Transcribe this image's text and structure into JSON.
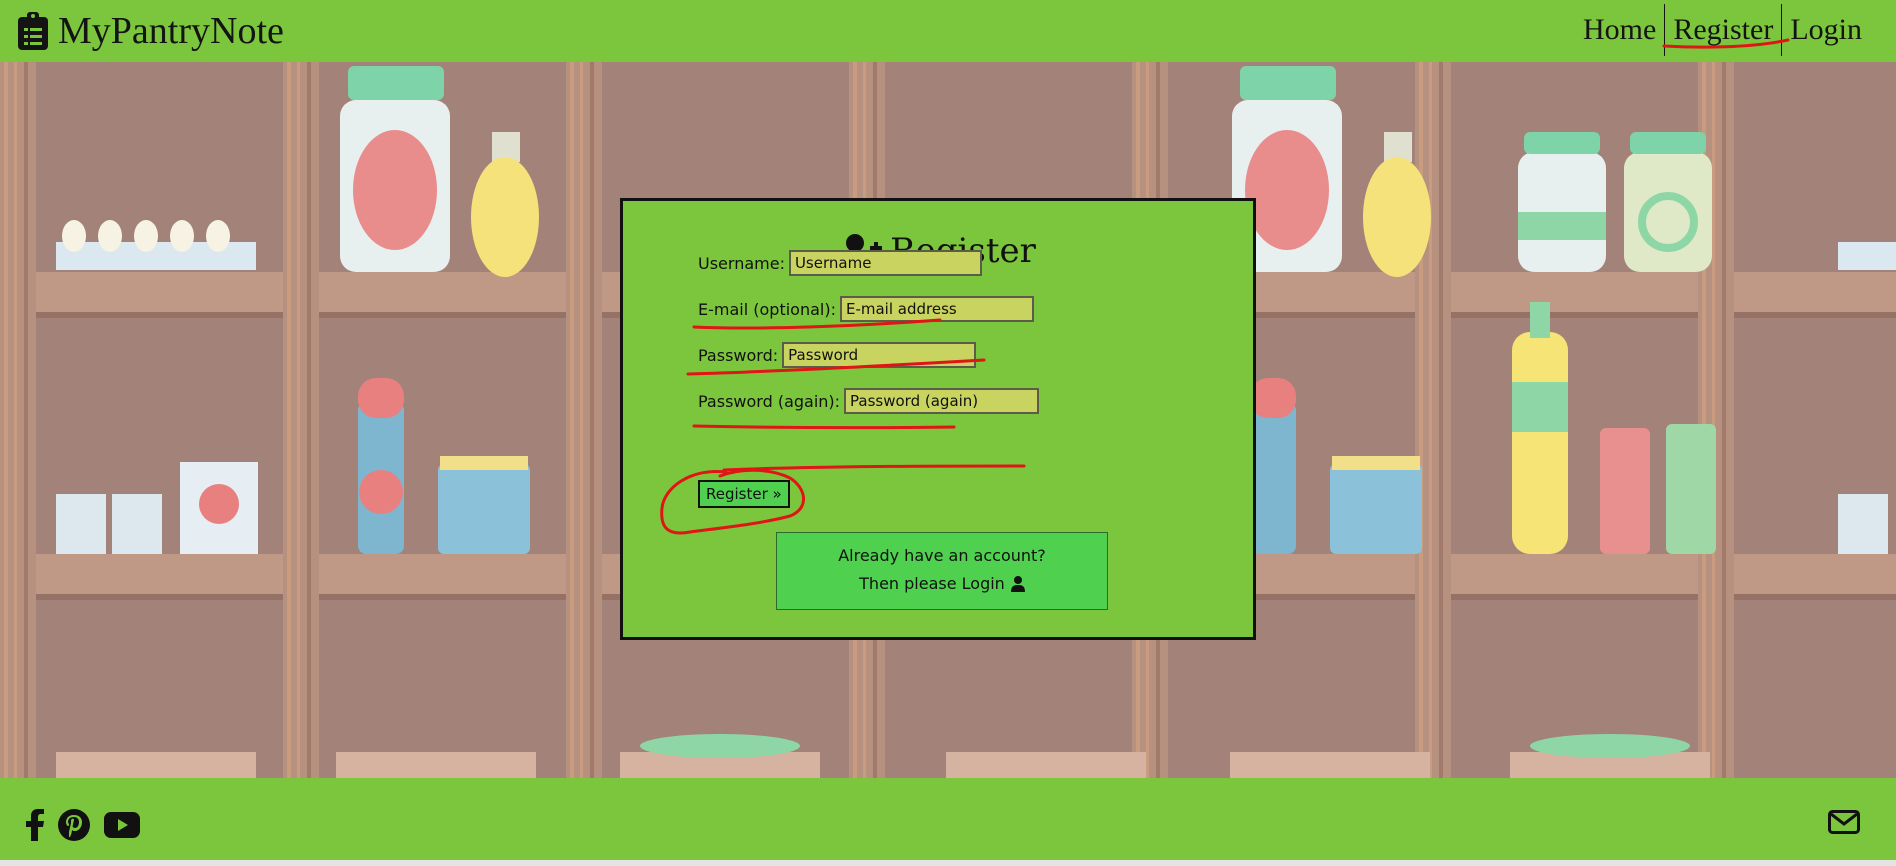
{
  "header": {
    "brand": "MyPantryNote",
    "nav": [
      {
        "label": "Home"
      },
      {
        "label": "Register"
      },
      {
        "label": "Login"
      }
    ]
  },
  "register_form": {
    "title": "Register",
    "fields": [
      {
        "label": "Username:",
        "placeholder": "Username"
      },
      {
        "label": "E-mail (optional):",
        "placeholder": "E-mail address"
      },
      {
        "label": "Password:",
        "placeholder": "Password"
      },
      {
        "label": "Password (again):",
        "placeholder": "Password (again)"
      }
    ],
    "submit_label": "Register »",
    "login_prompt": {
      "line1": "Already have an account?",
      "line2": "Then please Login"
    }
  },
  "footer": {
    "social_icons": [
      "facebook-icon",
      "pinterest-icon",
      "youtube-icon"
    ],
    "contact_icon": "envelope-icon"
  },
  "colors": {
    "accent_green": "#7cc63d",
    "button_green": "#4fd14f",
    "input_bg": "#c9d35f",
    "annotation_red": "#e01515"
  }
}
